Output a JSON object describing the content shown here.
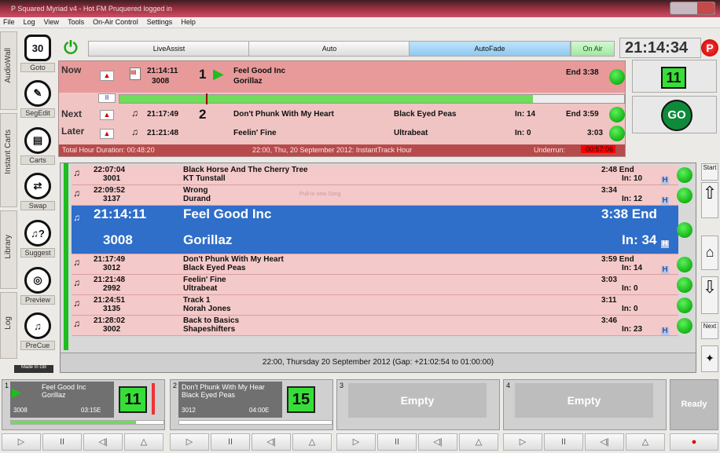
{
  "window": {
    "title": "P Squared Myriad v4 - Hot FM Pruquered logged in"
  },
  "menu": [
    "File",
    "Log",
    "View",
    "Tools",
    "On-Air Control",
    "Settings",
    "Help"
  ],
  "side_tabs": [
    "AudioWall",
    "Instant Carts",
    "Library",
    "Log"
  ],
  "tools": [
    {
      "label": "Goto",
      "glyph": "30"
    },
    {
      "label": "SegEdit",
      "glyph": "✎"
    },
    {
      "label": "Carts",
      "glyph": "▤"
    },
    {
      "label": "Swap",
      "glyph": "⇄"
    },
    {
      "label": "Suggest",
      "glyph": "♫?"
    },
    {
      "label": "Preview",
      "glyph": "◎"
    },
    {
      "label": "PreCue",
      "glyph": "♫"
    }
  ],
  "made_in_gb": "Made In GB",
  "modes": {
    "power_icon": "power-icon",
    "liveassist": "LiveAssist",
    "auto": "Auto",
    "autofade": "AutoFade",
    "onair": "On Air"
  },
  "clock": "21:14:34",
  "now": {
    "label": "Now",
    "time": "21:14:11",
    "cart": "3008",
    "index": "1",
    "title": "Feel Good Inc",
    "artist": "Gorillaz",
    "end": "End 3:38",
    "count": "11",
    "go": "GO"
  },
  "next": {
    "label": "Next",
    "time": "21:17:49",
    "index": "2",
    "title": "Don't Phunk With My Heart",
    "artist": "Black Eyed Peas",
    "in": "In: 14",
    "end": "End 3:59"
  },
  "later": {
    "label": "Later",
    "time": "21:21:48",
    "title": "Feelin' Fine",
    "artist": "Ultrabeat",
    "in": "In: 0",
    "end": "3:03"
  },
  "status": {
    "total": "Total Hour Duration: 00:48:20",
    "hour": "22:00, Thu, 20 September 2012: InstantTrack Hour",
    "underrun_label": "Underrun:",
    "underrun": "-00:57:06"
  },
  "playlist": [
    {
      "time": "22:07:04",
      "cart": "3001",
      "title": "Black Horse And The Cherry Tree",
      "artist": "KT Tunstall",
      "dur": "2:48 End",
      "in": "In: 10",
      "h": true
    },
    {
      "time": "22:09:52",
      "cart": "3137",
      "title": "Wrong",
      "artist": "Durand",
      "dur": "3:34",
      "in": "In: 12",
      "h": true,
      "note": "Pull-in new Song"
    },
    {
      "time": "21:14:11",
      "cart": "3008",
      "title": "Feel Good Inc",
      "artist": "Gorillaz",
      "dur": "3:38 End",
      "in": "In: 34",
      "h": true,
      "selected": true
    },
    {
      "time": "21:17:49",
      "cart": "3012",
      "title": "Don't Phunk With My Heart",
      "artist": "Black Eyed Peas",
      "dur": "3:59 End",
      "in": "In: 14",
      "h": true
    },
    {
      "time": "21:21:48",
      "cart": "2992",
      "title": "Feelin' Fine",
      "artist": "Ultrabeat",
      "dur": "3:03",
      "in": "In: 0",
      "h": false
    },
    {
      "time": "21:24:51",
      "cart": "3135",
      "title": "Track 1",
      "artist": "Norah Jones",
      "dur": "3:11",
      "in": "In: 0",
      "h": false
    },
    {
      "time": "21:28:02",
      "cart": "3002",
      "title": "Back to Basics",
      "artist": "Shapeshifters",
      "dur": "3:46",
      "in": "In: 23",
      "h": true
    }
  ],
  "playlist_footer": "22:00, Thursday 20 September 2012 (Gap: +21:02:54 to 01:00:00)",
  "right_nav": {
    "start": "Start",
    "next": "Next"
  },
  "players": [
    {
      "num": "1",
      "title": "Feel Good Inc",
      "artist": "Gorillaz",
      "cart": "3008",
      "time": "03:15E",
      "count": "11"
    },
    {
      "num": "2",
      "title": "Don't Phunk With My Hear",
      "artist": "Black Eyed Peas",
      "cart": "3012",
      "time": "04:00E",
      "count": "15"
    },
    {
      "num": "3",
      "empty": "Empty"
    },
    {
      "num": "4",
      "empty": "Empty"
    }
  ],
  "ready": "Ready"
}
